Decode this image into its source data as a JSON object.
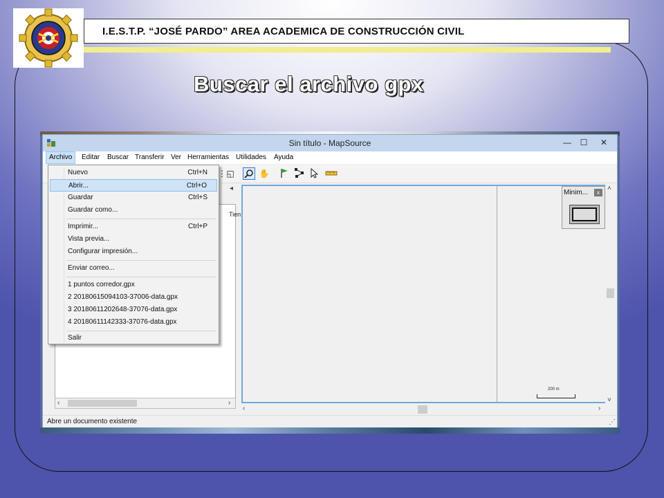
{
  "header": {
    "institution_title": "I.E.S.T.P. “JOSÉ PARDO” AREA ACADEMICA DE CONSTRUCCIÓN CIVIL",
    "slide_heading": "Buscar el archivo gpx"
  },
  "window": {
    "title": "Sin título - MapSource",
    "controls": {
      "minimize": "—",
      "maximize": "☐",
      "close": "✕"
    }
  },
  "menubar": {
    "items": [
      "Archivo",
      "Editar",
      "Buscar",
      "Transferir",
      "Ver",
      "Herramientas",
      "Utilidades",
      "Ayuda"
    ]
  },
  "file_menu": {
    "items": [
      {
        "label": "Nuevo",
        "shortcut": "Ctrl+N"
      },
      {
        "label": "Abrir...",
        "shortcut": "Ctrl+O"
      },
      {
        "label": "Guardar",
        "shortcut": "Ctrl+S"
      },
      {
        "label": "Guardar como...",
        "shortcut": ""
      },
      {
        "label": "Imprimir...",
        "shortcut": "Ctrl+P"
      },
      {
        "label": "Vista previa...",
        "shortcut": ""
      },
      {
        "label": "Configurar impresión...",
        "shortcut": ""
      },
      {
        "label": "Enviar correo...",
        "shortcut": ""
      },
      {
        "label": "1 puntos corredor.gpx",
        "shortcut": ""
      },
      {
        "label": "2 20180615094103-37006-data.gpx",
        "shortcut": ""
      },
      {
        "label": "3 20180611202648-37076-data.gpx",
        "shortcut": ""
      },
      {
        "label": "4 20180611142333-37076-data.gpx",
        "shortcut": ""
      },
      {
        "label": "Salir",
        "shortcut": ""
      }
    ],
    "highlighted": "Abrir..."
  },
  "left_panel": {
    "column_header": "Tien"
  },
  "minimap": {
    "title": "Minim...",
    "close": "x"
  },
  "map": {
    "scale_label": "200 m"
  },
  "statusbar": {
    "text": "Abre un documento existente"
  }
}
